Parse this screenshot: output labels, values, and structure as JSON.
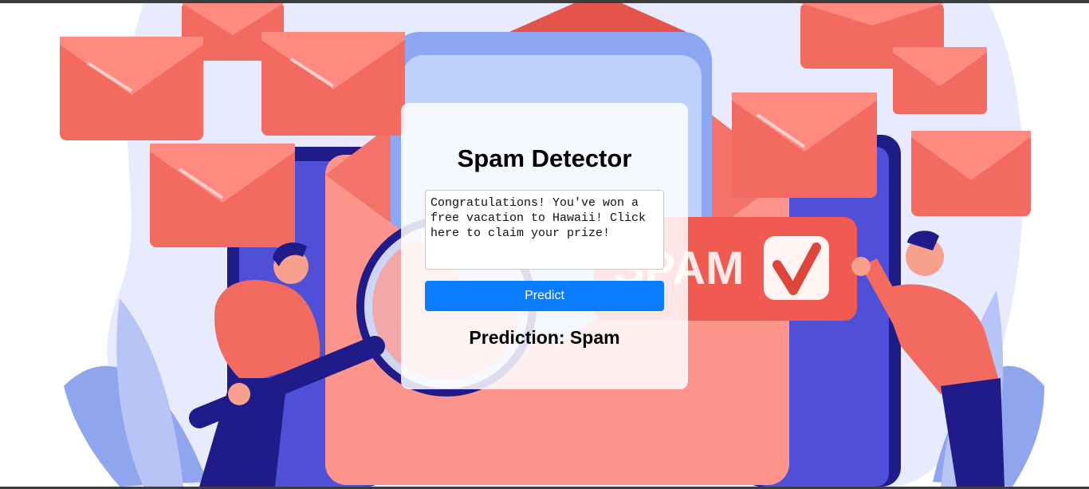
{
  "app": {
    "title": "Spam Detector"
  },
  "form": {
    "message_value": "Congratulations! You've won a free vacation to Hawaii! Click here to claim your prize!",
    "predict_label": "Predict",
    "result_text": "Prediction: Spam"
  },
  "background": {
    "badge_text": "SPAM",
    "colors": {
      "envelope": "#f2695f",
      "envelope_light": "#ff8b80",
      "phone_blue": "#4f4fd8",
      "phone_dark": "#1f1c8a",
      "blob": "#e8ecff",
      "button": "#0a7cff"
    }
  }
}
